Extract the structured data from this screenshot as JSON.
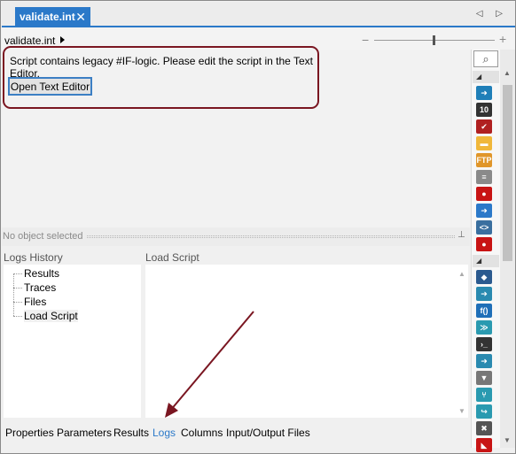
{
  "tab": {
    "title": "validate.int",
    "close": "✕"
  },
  "nav": {
    "arrows": "◁ ▷"
  },
  "breadcrumb": {
    "item": "validate.int"
  },
  "zoom": {
    "minus": "−",
    "plus": "+",
    "level_fraction": 0.49
  },
  "canvas": {
    "message": "Script contains legacy #IF-logic. Please edit the script in the Text Editor.",
    "button_label": "Open Text Editor"
  },
  "splitter": {
    "label": "No object selected"
  },
  "logs_history": {
    "title": "Logs History",
    "items": [
      "Results",
      "Traces",
      "Files",
      "Load Script"
    ],
    "selected": "Load Script"
  },
  "load_script": {
    "title": "Load Script"
  },
  "bottom_tabs": [
    "Properties",
    "Parameters",
    "Results",
    "Logs",
    "Columns",
    "Input/Output Files"
  ],
  "active_bottom_tab": "Logs",
  "toolbox": {
    "search_icon": "⌕",
    "collapse_glyph": "◢",
    "icons": [
      {
        "name": "import-icon",
        "glyph": "➜",
        "color": "#1f7fb8"
      },
      {
        "name": "binary-icon",
        "glyph": "10",
        "color": "#333333"
      },
      {
        "name": "checklist-icon",
        "glyph": "✔",
        "color": "#b02020"
      },
      {
        "name": "folder-icon",
        "glyph": "▬",
        "color": "#f0b73a"
      },
      {
        "name": "ftp-icon",
        "glyph": "FTP",
        "color": "#e0962a"
      },
      {
        "name": "list-icon",
        "glyph": "≡",
        "color": "#8a8a8a"
      },
      {
        "name": "stop-icon",
        "glyph": "●",
        "color": "#c81414"
      },
      {
        "name": "database-icon",
        "glyph": "➜",
        "color": "#2b79c9"
      },
      {
        "name": "script-icon",
        "glyph": "<>",
        "color": "#3a6f9f"
      },
      {
        "name": "record-icon",
        "glyph": "●",
        "color": "#c81414"
      },
      {
        "name": "shield-icon",
        "glyph": "◆",
        "color": "#2b5a8f"
      },
      {
        "name": "forward-icon",
        "glyph": "➔",
        "color": "#2a8ab0"
      },
      {
        "name": "function-icon",
        "glyph": "f()",
        "color": "#1f6fb8"
      },
      {
        "name": "merge-icon",
        "glyph": "≫",
        "color": "#2a9ab0"
      },
      {
        "name": "terminal-icon",
        "glyph": "›_",
        "color": "#333333"
      },
      {
        "name": "export-icon",
        "glyph": "➜",
        "color": "#2a8ab0"
      },
      {
        "name": "filter-icon",
        "glyph": "▼",
        "color": "#777777"
      },
      {
        "name": "split-icon",
        "glyph": "⑂",
        "color": "#2a9ab0"
      },
      {
        "name": "route-icon",
        "glyph": "↪",
        "color": "#2a9ab0"
      },
      {
        "name": "delete-icon",
        "glyph": "✖",
        "color": "#555555"
      },
      {
        "name": "end-icon",
        "glyph": "◣",
        "color": "#c81414"
      }
    ]
  },
  "scroll": {
    "up": "▲",
    "down": "▼"
  },
  "colors": {
    "accent": "#2b79c9",
    "annotation": "#7a1621"
  }
}
